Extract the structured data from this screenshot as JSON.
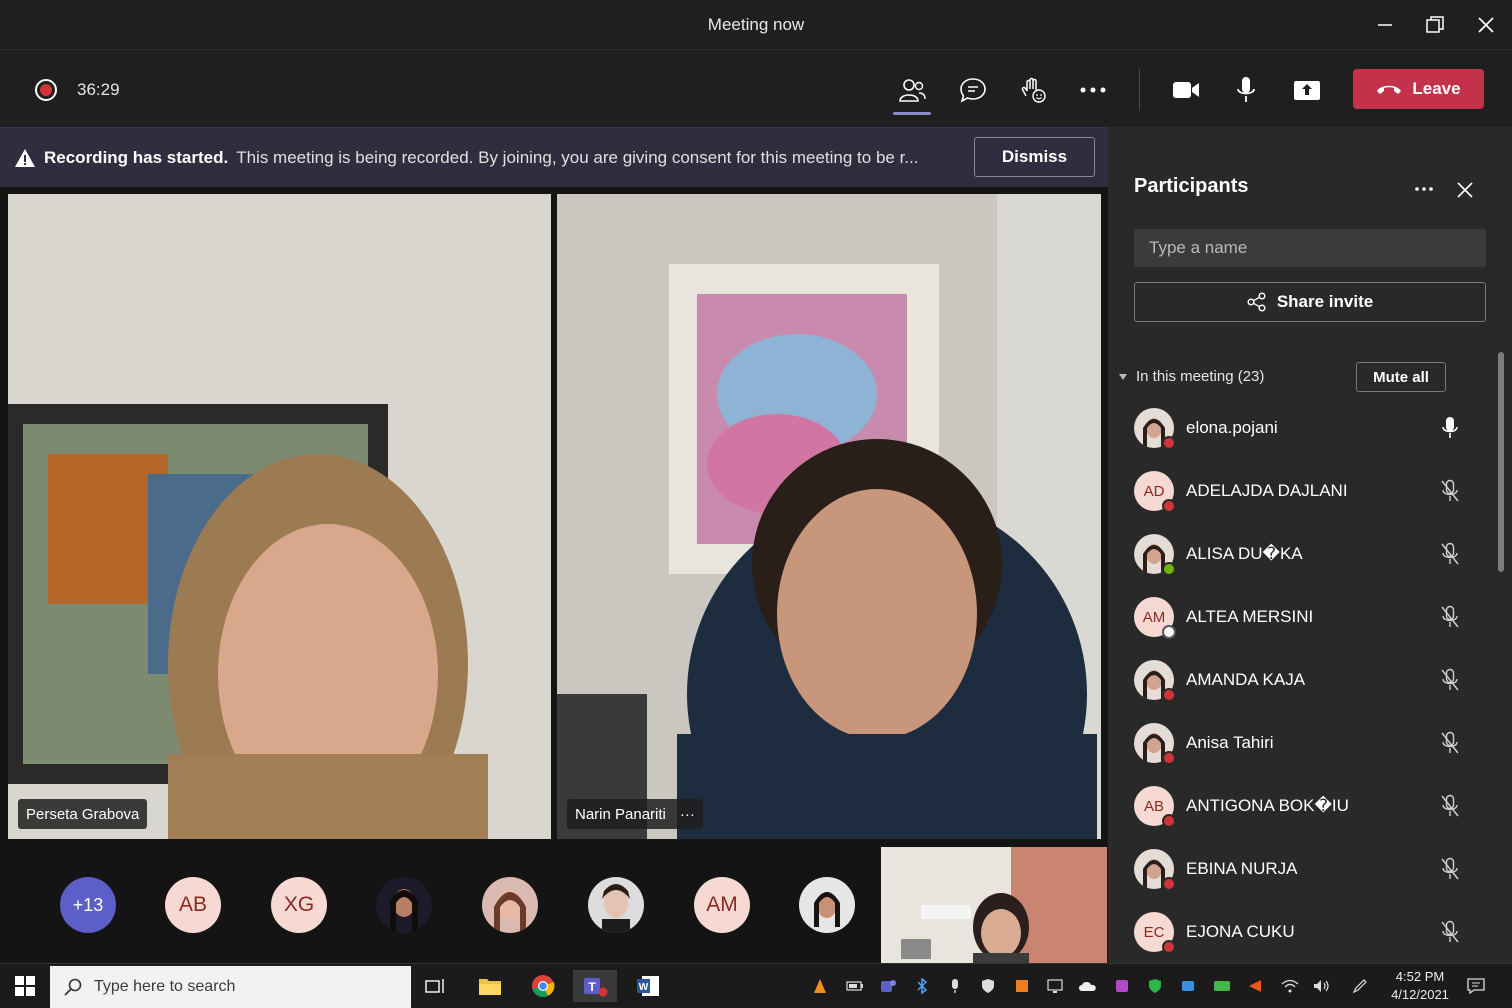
{
  "window": {
    "title": "Meeting now"
  },
  "toolbar": {
    "timer": "36:29",
    "leave_label": "Leave"
  },
  "banner": {
    "bold": "Recording has started.",
    "text": "This meeting is being recorded. By joining, you are giving consent for this meeting to be r...",
    "dismiss_label": "Dismiss"
  },
  "videos": {
    "left_name": "Perseta Grabova",
    "right_name": "Narin Panariti",
    "right_more": "···"
  },
  "bubbles": {
    "more": "+13",
    "b1": "AB",
    "b2": "XG",
    "b3": "AM"
  },
  "panel": {
    "title": "Participants",
    "search_placeholder": "Type a name",
    "share_label": "Share invite",
    "section_label": "In this meeting (23)",
    "mute_all_label": "Mute all",
    "participants": [
      {
        "name": "elona.pojani",
        "initials": "",
        "status": "busy",
        "mic": "on"
      },
      {
        "name": "ADELAJDA DAJLANI",
        "initials": "AD",
        "status": "busy",
        "mic": "off"
      },
      {
        "name": "ALISA DU�KA",
        "initials": "",
        "status": "available",
        "mic": "off"
      },
      {
        "name": "ALTEA MERSINI",
        "initials": "AM",
        "status": "offline",
        "mic": "off"
      },
      {
        "name": "AMANDA KAJA",
        "initials": "",
        "status": "busy",
        "mic": "off"
      },
      {
        "name": "Anisa Tahiri",
        "initials": "",
        "status": "busy",
        "mic": "off"
      },
      {
        "name": "ANTIGONA BOK�IU",
        "initials": "AB",
        "status": "busy",
        "mic": "off"
      },
      {
        "name": "EBINA NURJA",
        "initials": "",
        "status": "busy",
        "mic": "off"
      },
      {
        "name": "EJONA CUKU",
        "initials": "EC",
        "status": "busy",
        "mic": "off"
      }
    ]
  },
  "colors": {
    "leave": "#c4314b",
    "accent": "#5b5fc7",
    "busy": "#d13438",
    "available": "#6bb700"
  },
  "taskbar": {
    "search_placeholder": "Type here to search",
    "time": "4:52 PM",
    "date": "4/12/2021"
  }
}
